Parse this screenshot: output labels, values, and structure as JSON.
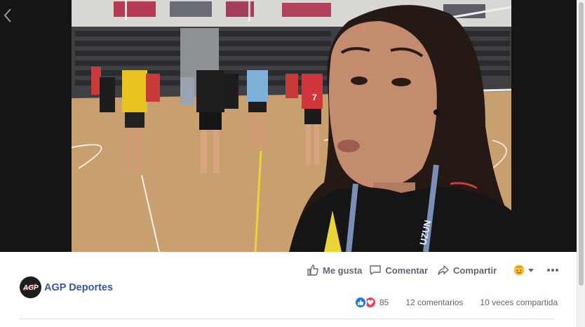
{
  "page": {
    "name": "AGP Deportes",
    "avatar_icon": "agp-logo-icon",
    "avatar_text": "AGP"
  },
  "actions": {
    "like_label": "Me gusta",
    "comment_label": "Comentar",
    "share_label": "Compartir"
  },
  "stats": {
    "reactions_count": "85",
    "comments": "12 comentarios",
    "shares": "10 veces compartida"
  },
  "video": {
    "jersey_number": "7",
    "lanyard_text": "UZUN"
  },
  "colors": {
    "link_blue": "#385898",
    "action_gray": "#606770",
    "like_blue": "#1877f2",
    "love_red": "#f33e58"
  }
}
